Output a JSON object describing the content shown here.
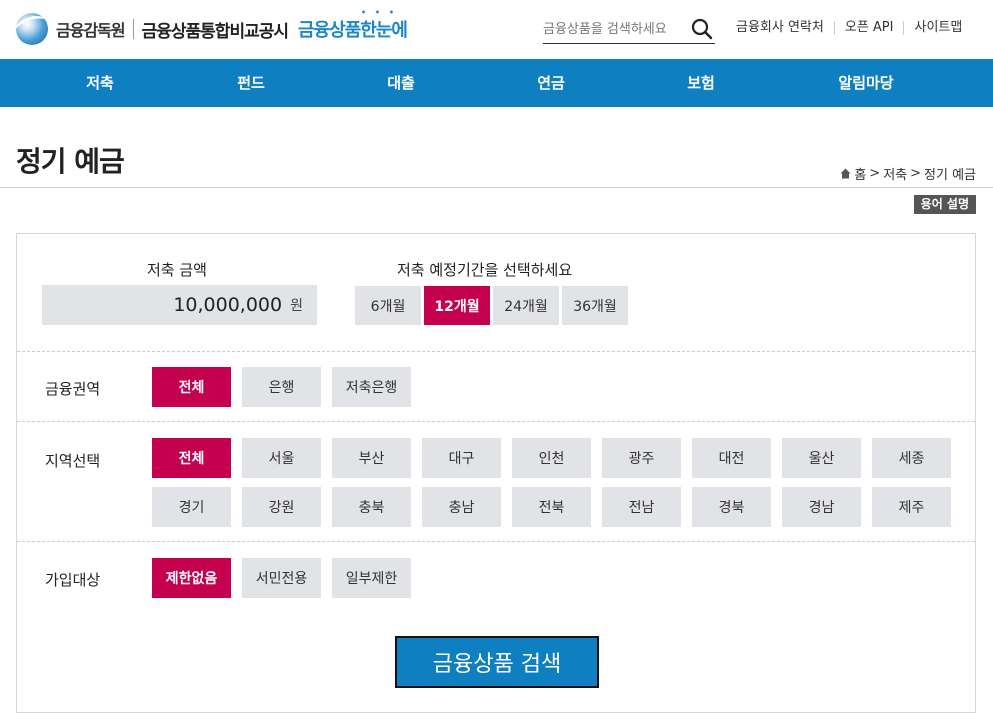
{
  "header": {
    "fss_name": "금융감독원",
    "site_name": "금융상품통합비교공시",
    "brand": "금융상품한눈에",
    "search_placeholder": "금융상품을 검색하세요",
    "util_links": [
      "금융회사 연락처",
      "오픈 API",
      "사이트맵"
    ]
  },
  "nav": [
    "저축",
    "펀드",
    "대출",
    "연금",
    "보험",
    "알림마당"
  ],
  "page": {
    "title": "정기 예금",
    "breadcrumb": [
      "홈",
      "저축",
      "정기 예금"
    ],
    "glossary": "용어 설명"
  },
  "form": {
    "amount_label": "저축 금액",
    "amount_value": "10,000,000",
    "amount_unit": "원",
    "period_label": "저축 예정기간을 선택하세요",
    "periods": [
      "6개월",
      "12개월",
      "24개월",
      "36개월"
    ],
    "selected_period": "12개월",
    "sector_label": "금융권역",
    "sectors": [
      "전체",
      "은행",
      "저축은행"
    ],
    "region_label": "지역선택",
    "regions_row1": [
      "전체",
      "서울",
      "부산",
      "대구",
      "인천",
      "광주",
      "대전",
      "울산",
      "세종"
    ],
    "regions_row2": [
      "경기",
      "강원",
      "충북",
      "충남",
      "전북",
      "전남",
      "경북",
      "경남",
      "제주"
    ],
    "target_label": "가입대상",
    "targets": [
      "제한없음",
      "서민전용",
      "일부제한"
    ],
    "submit": "금융상품 검색"
  },
  "colors": {
    "nav_bg": "#0e7fc1",
    "active": "#c4004f",
    "option_bg": "#e2e3e7"
  }
}
